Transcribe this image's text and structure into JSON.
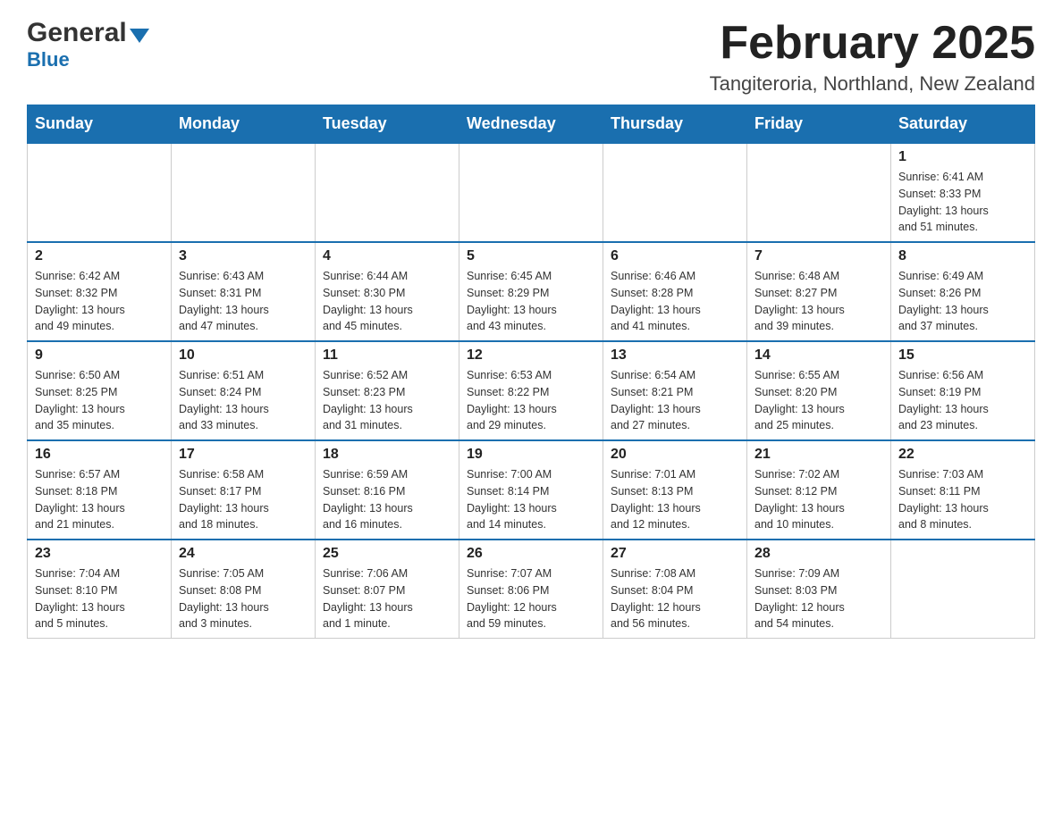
{
  "header": {
    "logo_general": "General",
    "logo_blue": "Blue",
    "month_title": "February 2025",
    "location": "Tangiteroria, Northland, New Zealand"
  },
  "weekdays": [
    "Sunday",
    "Monday",
    "Tuesday",
    "Wednesday",
    "Thursday",
    "Friday",
    "Saturday"
  ],
  "weeks": [
    [
      {
        "day": "",
        "info": ""
      },
      {
        "day": "",
        "info": ""
      },
      {
        "day": "",
        "info": ""
      },
      {
        "day": "",
        "info": ""
      },
      {
        "day": "",
        "info": ""
      },
      {
        "day": "",
        "info": ""
      },
      {
        "day": "1",
        "info": "Sunrise: 6:41 AM\nSunset: 8:33 PM\nDaylight: 13 hours\nand 51 minutes."
      }
    ],
    [
      {
        "day": "2",
        "info": "Sunrise: 6:42 AM\nSunset: 8:32 PM\nDaylight: 13 hours\nand 49 minutes."
      },
      {
        "day": "3",
        "info": "Sunrise: 6:43 AM\nSunset: 8:31 PM\nDaylight: 13 hours\nand 47 minutes."
      },
      {
        "day": "4",
        "info": "Sunrise: 6:44 AM\nSunset: 8:30 PM\nDaylight: 13 hours\nand 45 minutes."
      },
      {
        "day": "5",
        "info": "Sunrise: 6:45 AM\nSunset: 8:29 PM\nDaylight: 13 hours\nand 43 minutes."
      },
      {
        "day": "6",
        "info": "Sunrise: 6:46 AM\nSunset: 8:28 PM\nDaylight: 13 hours\nand 41 minutes."
      },
      {
        "day": "7",
        "info": "Sunrise: 6:48 AM\nSunset: 8:27 PM\nDaylight: 13 hours\nand 39 minutes."
      },
      {
        "day": "8",
        "info": "Sunrise: 6:49 AM\nSunset: 8:26 PM\nDaylight: 13 hours\nand 37 minutes."
      }
    ],
    [
      {
        "day": "9",
        "info": "Sunrise: 6:50 AM\nSunset: 8:25 PM\nDaylight: 13 hours\nand 35 minutes."
      },
      {
        "day": "10",
        "info": "Sunrise: 6:51 AM\nSunset: 8:24 PM\nDaylight: 13 hours\nand 33 minutes."
      },
      {
        "day": "11",
        "info": "Sunrise: 6:52 AM\nSunset: 8:23 PM\nDaylight: 13 hours\nand 31 minutes."
      },
      {
        "day": "12",
        "info": "Sunrise: 6:53 AM\nSunset: 8:22 PM\nDaylight: 13 hours\nand 29 minutes."
      },
      {
        "day": "13",
        "info": "Sunrise: 6:54 AM\nSunset: 8:21 PM\nDaylight: 13 hours\nand 27 minutes."
      },
      {
        "day": "14",
        "info": "Sunrise: 6:55 AM\nSunset: 8:20 PM\nDaylight: 13 hours\nand 25 minutes."
      },
      {
        "day": "15",
        "info": "Sunrise: 6:56 AM\nSunset: 8:19 PM\nDaylight: 13 hours\nand 23 minutes."
      }
    ],
    [
      {
        "day": "16",
        "info": "Sunrise: 6:57 AM\nSunset: 8:18 PM\nDaylight: 13 hours\nand 21 minutes."
      },
      {
        "day": "17",
        "info": "Sunrise: 6:58 AM\nSunset: 8:17 PM\nDaylight: 13 hours\nand 18 minutes."
      },
      {
        "day": "18",
        "info": "Sunrise: 6:59 AM\nSunset: 8:16 PM\nDaylight: 13 hours\nand 16 minutes."
      },
      {
        "day": "19",
        "info": "Sunrise: 7:00 AM\nSunset: 8:14 PM\nDaylight: 13 hours\nand 14 minutes."
      },
      {
        "day": "20",
        "info": "Sunrise: 7:01 AM\nSunset: 8:13 PM\nDaylight: 13 hours\nand 12 minutes."
      },
      {
        "day": "21",
        "info": "Sunrise: 7:02 AM\nSunset: 8:12 PM\nDaylight: 13 hours\nand 10 minutes."
      },
      {
        "day": "22",
        "info": "Sunrise: 7:03 AM\nSunset: 8:11 PM\nDaylight: 13 hours\nand 8 minutes."
      }
    ],
    [
      {
        "day": "23",
        "info": "Sunrise: 7:04 AM\nSunset: 8:10 PM\nDaylight: 13 hours\nand 5 minutes."
      },
      {
        "day": "24",
        "info": "Sunrise: 7:05 AM\nSunset: 8:08 PM\nDaylight: 13 hours\nand 3 minutes."
      },
      {
        "day": "25",
        "info": "Sunrise: 7:06 AM\nSunset: 8:07 PM\nDaylight: 13 hours\nand 1 minute."
      },
      {
        "day": "26",
        "info": "Sunrise: 7:07 AM\nSunset: 8:06 PM\nDaylight: 12 hours\nand 59 minutes."
      },
      {
        "day": "27",
        "info": "Sunrise: 7:08 AM\nSunset: 8:04 PM\nDaylight: 12 hours\nand 56 minutes."
      },
      {
        "day": "28",
        "info": "Sunrise: 7:09 AM\nSunset: 8:03 PM\nDaylight: 12 hours\nand 54 minutes."
      },
      {
        "day": "",
        "info": ""
      }
    ]
  ]
}
